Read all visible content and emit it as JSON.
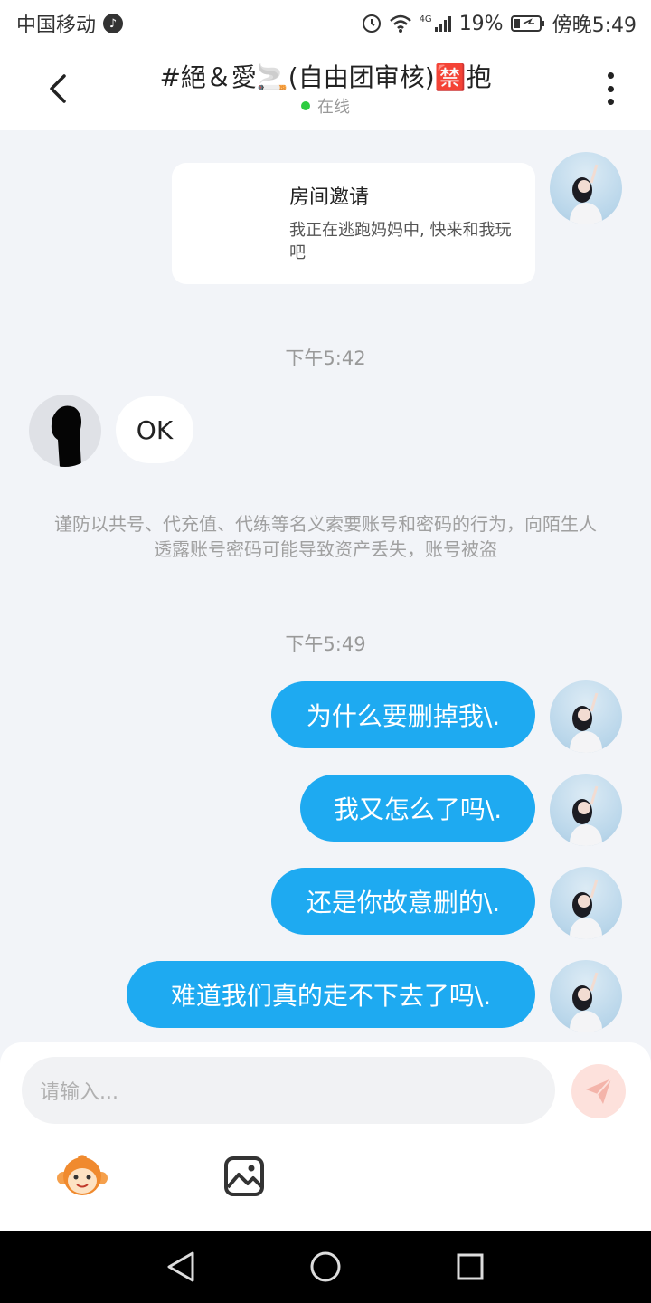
{
  "status_bar": {
    "carrier": "中国移动",
    "network": "4G",
    "battery": "19%",
    "time": "傍晚5:49"
  },
  "header": {
    "title": "#絕＆愛🚬(自由团审核)🈲抱",
    "status": "在线"
  },
  "messages": {
    "invite_card": {
      "title": "房间邀请",
      "text": "我正在逃跑妈妈中, 快来和我玩吧"
    },
    "time1": "下午5:42",
    "incoming_ok": "OK",
    "warning": "谨防以共号、代充值、代练等名义索要账号和密码的行为，向陌生人透露账号密码可能导致资产丢失，账号被盗",
    "time2": "下午5:49",
    "out": [
      "为什么要删掉我\\.",
      "我又怎么了吗\\.",
      "还是你故意删的\\.",
      "难道我们真的走不下去了吗\\."
    ]
  },
  "input": {
    "placeholder": "请输入..."
  },
  "colors": {
    "bubble_out": "#1eaaf1",
    "online_dot": "#2ecc40",
    "send_bg": "#fde1dc",
    "send_icon": "#f4b4aa"
  },
  "icons": {
    "back": "chevron-left-icon",
    "more": "more-vertical-icon",
    "send": "paper-plane-icon",
    "emoji": "monkey-emoji-icon",
    "image": "image-icon"
  }
}
